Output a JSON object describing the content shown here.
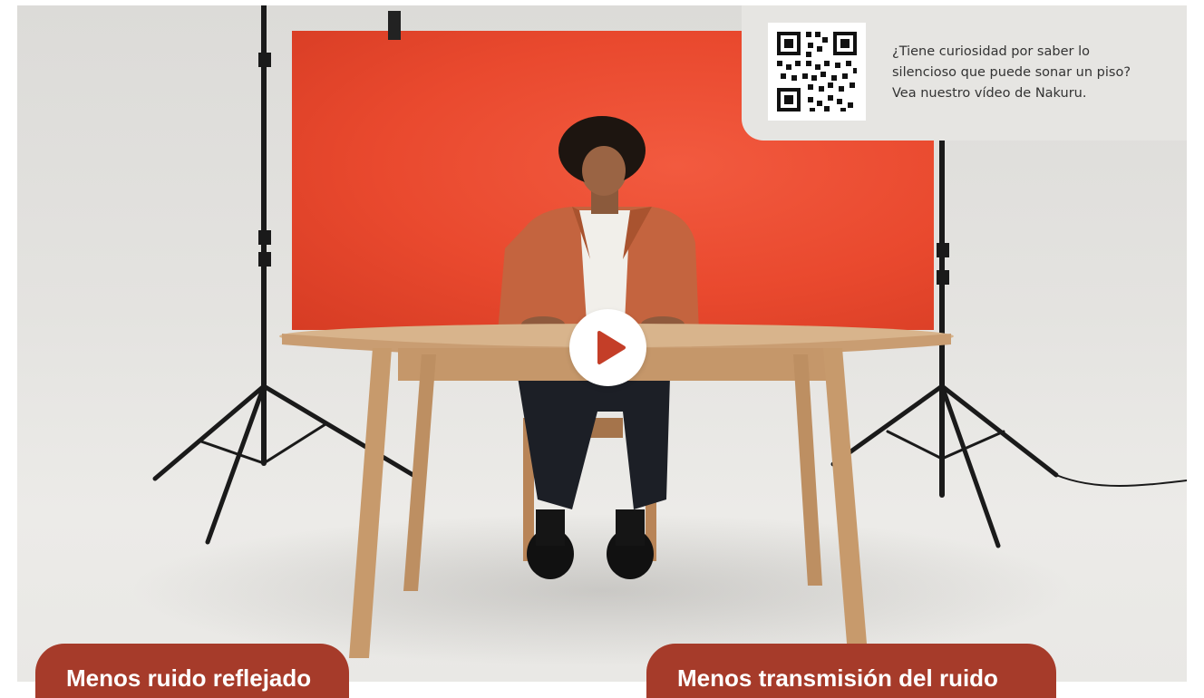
{
  "qr_card": {
    "text_lines": [
      "¿Tiene curiosidad por saber lo",
      "silencioso que puede sonar un piso?",
      "Vea nuestro vídeo de Nakuru."
    ]
  },
  "video": {
    "play_icon": "play-icon",
    "colors": {
      "backdrop": "#e9492e",
      "play_triangle": "#c43e28",
      "pill_background": "#a63b2a"
    }
  },
  "pills": {
    "left_label": "Menos ruido reflejado",
    "right_label": "Menos transmisión del ruido"
  }
}
